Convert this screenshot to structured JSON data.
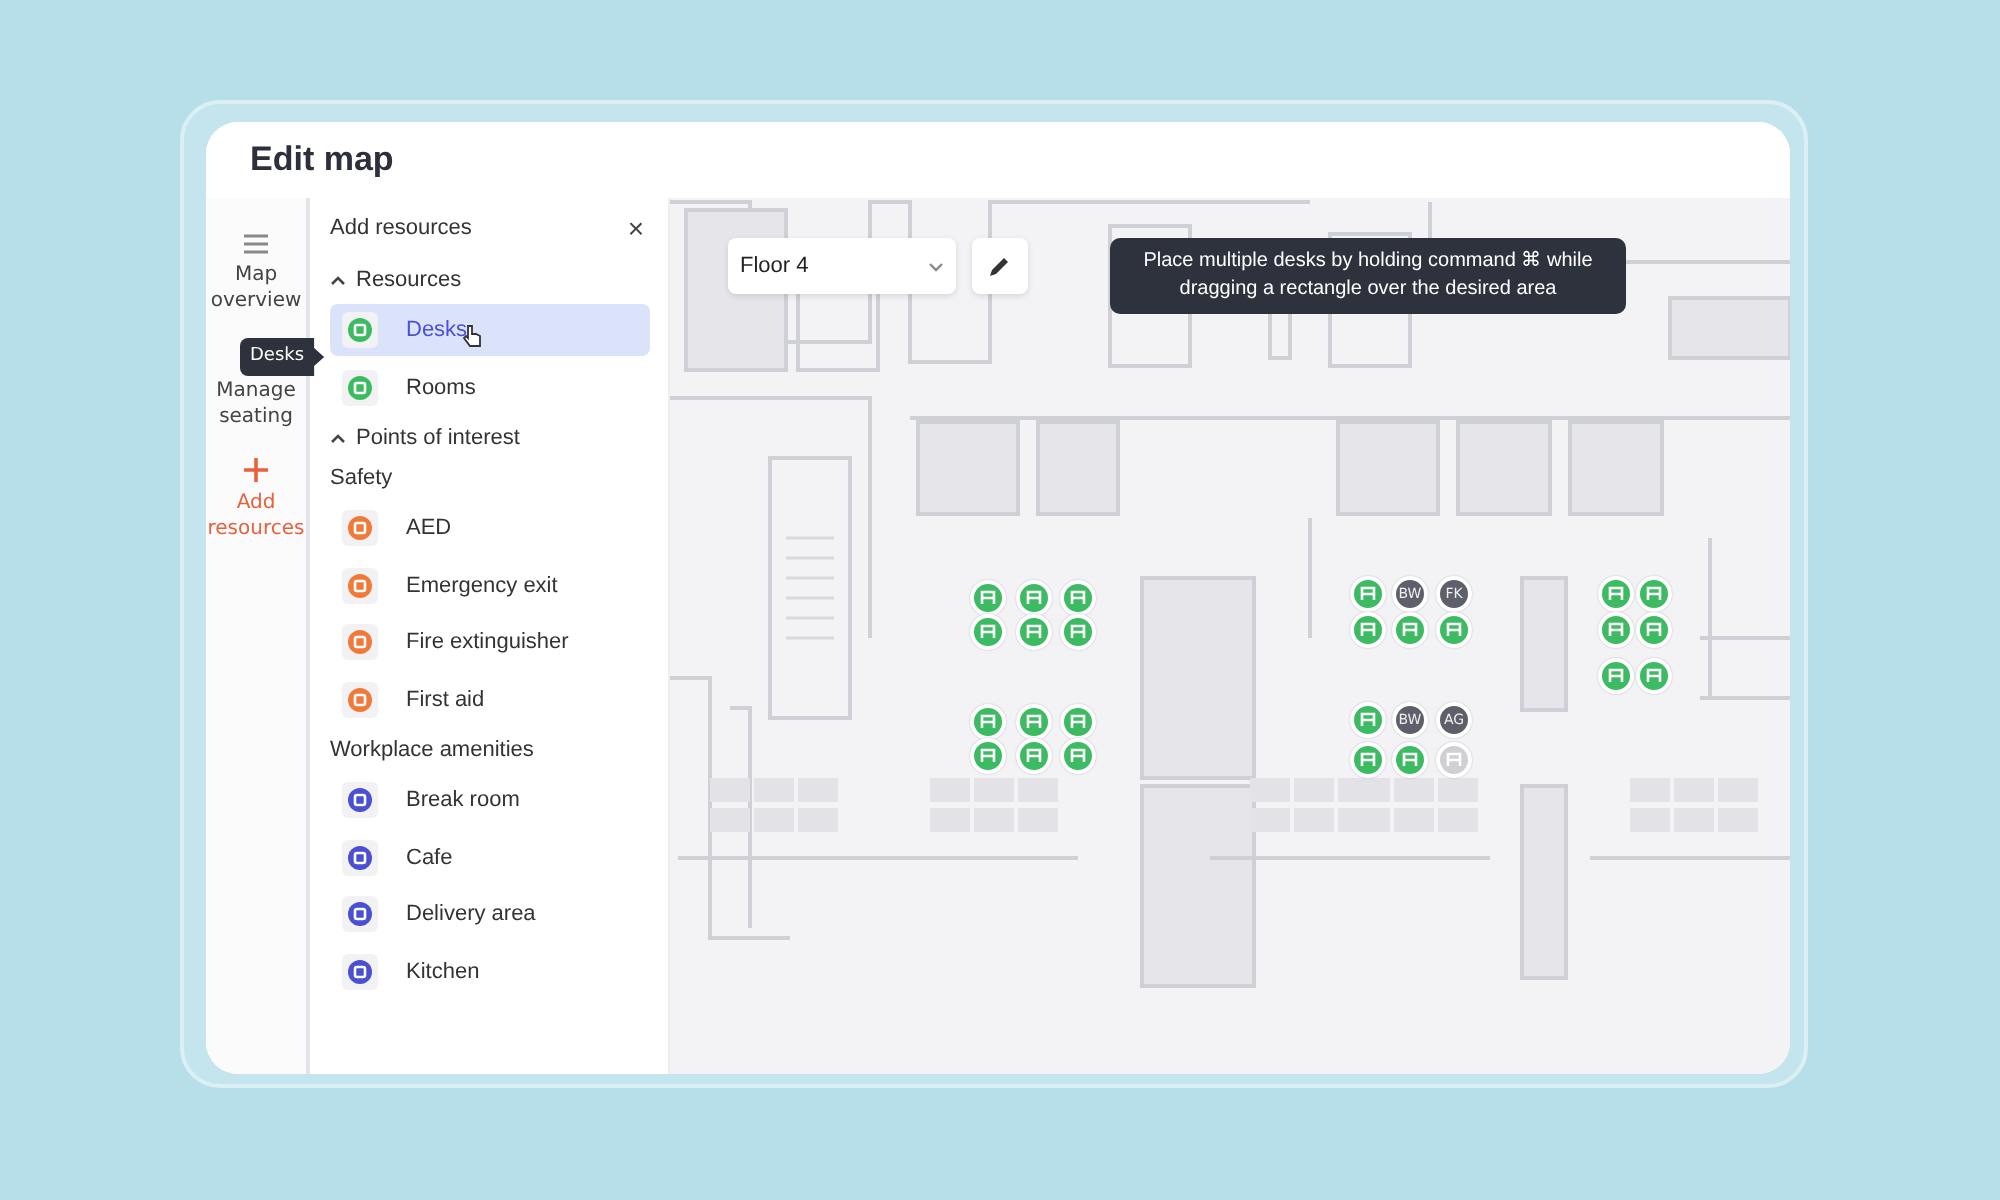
{
  "window": {
    "title": "Edit map"
  },
  "nav": [
    {
      "label": "Map overview",
      "kind": "list",
      "selected": false
    },
    {
      "label": "Manage seating",
      "selected": false
    },
    {
      "label": "Add resources",
      "kind": "plus",
      "selected": true
    }
  ],
  "nav_tooltip": "Desks",
  "panel": {
    "title": "Add resources",
    "close": "×",
    "sections": [
      {
        "title": "Resources",
        "expanded": true,
        "groups": [
          {
            "items": [
              {
                "label": "Desks",
                "color": "#3dbb62",
                "selected": true
              },
              {
                "label": "Rooms",
                "color": "#3dbb62",
                "selected": false
              }
            ]
          }
        ]
      },
      {
        "title": "Points of interest",
        "expanded": true,
        "groups": [
          {
            "title": "Safety",
            "items": [
              {
                "label": "AED",
                "color": "#f07a3a",
                "selected": false
              },
              {
                "label": "Emergency exit",
                "color": "#f07a3a",
                "selected": false
              },
              {
                "label": "Fire extinguisher",
                "color": "#f07a3a",
                "selected": false
              },
              {
                "label": "First aid",
                "color": "#f07a3a",
                "selected": false
              }
            ]
          },
          {
            "title": "Workplace amenities",
            "items": [
              {
                "label": "Break room",
                "color": "#4b4fd1",
                "selected": false
              },
              {
                "label": "Cafe",
                "color": "#4b4fd1",
                "selected": false
              },
              {
                "label": "Delivery area",
                "color": "#4b4fd1",
                "selected": false
              },
              {
                "label": "Kitchen",
                "color": "#4b4fd1",
                "selected": false
              }
            ]
          }
        ]
      }
    ]
  },
  "map": {
    "floor_select": {
      "value": "Floor 4"
    },
    "tooltip": "Place multiple desks by holding command ⌘ while dragging a rectangle over the desired area",
    "desks": [
      {
        "kind": "free"
      },
      {
        "kind": "free"
      },
      {
        "kind": "free"
      },
      {
        "kind": "free"
      },
      {
        "kind": "free"
      },
      {
        "kind": "free"
      },
      {
        "kind": "free"
      },
      {
        "kind": "free"
      },
      {
        "kind": "free"
      },
      {
        "kind": "free"
      },
      {
        "kind": "free"
      },
      {
        "kind": "free"
      },
      {
        "kind": "free"
      },
      {
        "kind": "occupied",
        "initials": "BW"
      },
      {
        "kind": "occupied",
        "initials": "FK"
      },
      {
        "kind": "free"
      },
      {
        "kind": "free"
      },
      {
        "kind": "free"
      },
      {
        "kind": "free"
      },
      {
        "kind": "occupied",
        "initials": "BW"
      },
      {
        "kind": "occupied",
        "initials": "AG"
      },
      {
        "kind": "free"
      },
      {
        "kind": "free"
      },
      {
        "kind": "disabled"
      },
      {
        "kind": "free"
      },
      {
        "kind": "free"
      },
      {
        "kind": "free"
      },
      {
        "kind": "free"
      },
      {
        "kind": "free"
      },
      {
        "kind": "free"
      }
    ]
  }
}
